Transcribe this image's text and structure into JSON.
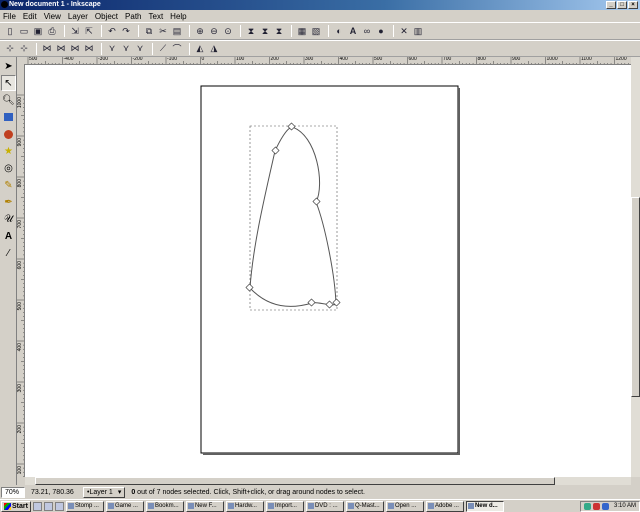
{
  "window": {
    "title": "New document 1 - Inkscape"
  },
  "menu": [
    "File",
    "Edit",
    "View",
    "Layer",
    "Object",
    "Path",
    "Text",
    "Help"
  ],
  "toolbar1_icons": [
    "new-icon",
    "open-icon",
    "save-icon",
    "print-icon",
    "import-icon",
    "export-icon",
    "undo-icon",
    "redo-icon",
    "copy-icon",
    "cut-icon",
    "paste-icon",
    "zoom-selection-icon",
    "zoom-drawing-icon",
    "zoom-page-icon",
    "duplicate-icon",
    "clone-icon",
    "unlink-clone-icon",
    "group-icon",
    "ungroup-icon",
    "fill-stroke-icon",
    "text-font-icon",
    "xml-editor-icon",
    "align-icon",
    "preferences-icon"
  ],
  "toolbar2_icons": [
    "insert-node-icon",
    "delete-node-icon",
    "join-nodes-icon",
    "break-path-icon",
    "join-segment-icon",
    "delete-segment-icon",
    "node-cusp-icon",
    "node-smooth-icon",
    "node-symmetric-icon",
    "segment-line-icon",
    "segment-curve-icon",
    "object-to-path-icon",
    "stroke-to-path-icon"
  ],
  "toolbox": [
    "selector-tool",
    "node-tool",
    "zoom-tool",
    "rectangle-tool",
    "ellipse-tool",
    "star-tool",
    "spiral-tool",
    "pencil-tool",
    "pen-tool",
    "calligraphy-tool",
    "text-tool",
    "dropper-tool"
  ],
  "ruler": {
    "h_ticks": [
      "500",
      "-400",
      "-300",
      "-200",
      "-100",
      "0",
      "100",
      "200",
      "300",
      "400",
      "500",
      "600",
      "700",
      "800",
      "900",
      "1000",
      "1100",
      "1200"
    ],
    "v_ticks": [
      "1000",
      "900",
      "800",
      "700",
      "600",
      "500",
      "400",
      "300",
      "200",
      "100"
    ]
  },
  "status": {
    "zoom": "70%",
    "coords": "73.21, 780.36",
    "layer": "•Layer 1",
    "message_bold": "0",
    "message": " out of 7 nodes selected. Click, Shift+click, or drag around nodes to select."
  },
  "taskbar": {
    "start": "Start",
    "tasks": [
      "Stomp ...",
      "Game ...",
      "Bookm...",
      "New F...",
      "Hardw...",
      "Import...",
      "DVD : ...",
      "Q-Mast...",
      "Open ...",
      "Adobe ...",
      "New d..."
    ],
    "active_task": 10,
    "clock": "3:10 AM"
  }
}
